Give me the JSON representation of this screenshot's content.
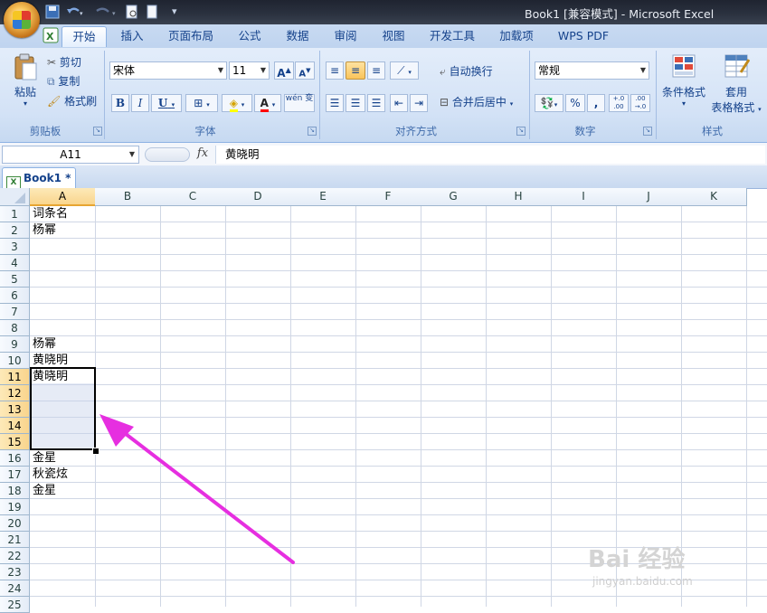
{
  "window": {
    "title": "Book1  [兼容模式]  -  Microsoft Excel"
  },
  "ribbon": {
    "tabs": [
      "开始",
      "插入",
      "页面布局",
      "公式",
      "数据",
      "审阅",
      "视图",
      "开发工具",
      "加载项",
      "WPS PDF"
    ],
    "active_tab": "开始",
    "clipboard": {
      "paste": "粘贴",
      "cut": "剪切",
      "copy": "复制",
      "format_painter": "格式刷",
      "label": "剪贴板"
    },
    "font": {
      "name": "宋体",
      "size": "11",
      "grow": "A",
      "shrink": "A",
      "bold": "B",
      "italic": "I",
      "underline": "U",
      "font_color_glyph": "A",
      "phonetic": "wén 变",
      "label": "字体"
    },
    "alignment": {
      "wrap_text": "自动换行",
      "merge_center": "合并后居中",
      "label": "对齐方式"
    },
    "number": {
      "format": "常规",
      "percent": "%",
      "comma": ",",
      "inc_decimal": "+.0 .00",
      "dec_decimal": ".00 →.0",
      "label": "数字"
    },
    "styles": {
      "conditional_format": "条件格式",
      "table_format_line1": "套用",
      "table_format_line2": "表格格式",
      "label": "样式"
    }
  },
  "formula_bar": {
    "name_box": "A11",
    "fx": "fx",
    "content": "黄晓明"
  },
  "workbook_tab": "Book1 *",
  "columns": [
    "A",
    "B",
    "C",
    "D",
    "E",
    "F",
    "G",
    "H",
    "I",
    "J",
    "K"
  ],
  "selected_column": "A",
  "rows": [
    "1",
    "2",
    "3",
    "4",
    "5",
    "6",
    "7",
    "8",
    "9",
    "10",
    "11",
    "12",
    "13",
    "14",
    "15",
    "16",
    "17",
    "18",
    "19",
    "20",
    "21",
    "22",
    "23",
    "24",
    "25"
  ],
  "selected_rows": [
    "11",
    "12",
    "13",
    "14",
    "15"
  ],
  "cells": {
    "A1": "词条名",
    "A2": "杨幂",
    "A9": "杨幂",
    "A10": "黄晓明",
    "A11": "黄晓明",
    "A16": "金星",
    "A17": "秋瓷炫",
    "A18": "金星"
  },
  "annotation": {
    "arrow_color": "#e62fe0"
  },
  "watermark": {
    "line1": "Bai 经验",
    "line2": "jingyan.baidu.com"
  }
}
